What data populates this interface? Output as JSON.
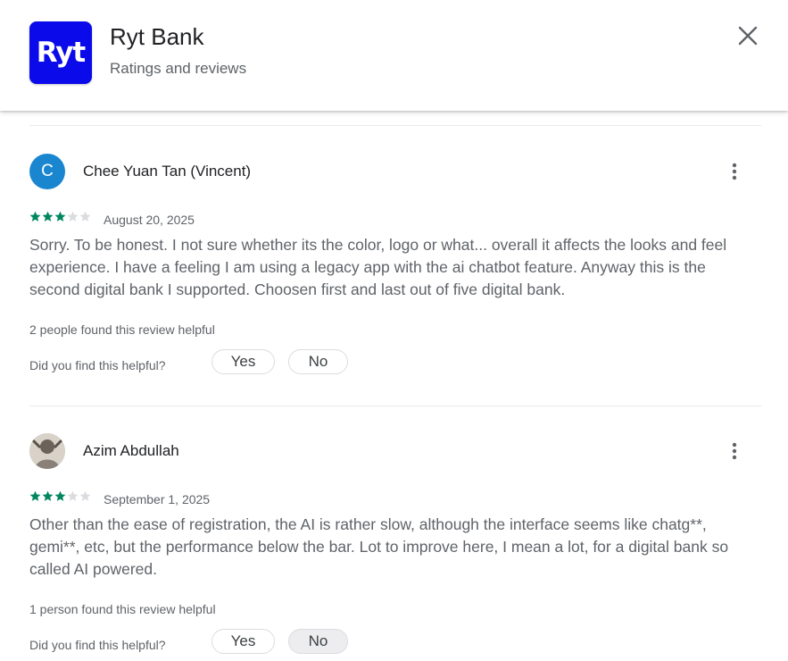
{
  "app": {
    "name": "Ryt Bank",
    "subtitle": "Ratings and reviews",
    "icon_text": "Ryt",
    "icon_color": "#0a0aeb",
    "icon_name": "ryt-bank-logo"
  },
  "header": {
    "close_icon": "close-icon"
  },
  "colors": {
    "star_filled": "#01875f",
    "star_empty": "#dadce0",
    "avatar_c": "#1a86d0"
  },
  "reviews": [
    {
      "name": "Chee Yuan Tan (Vincent)",
      "avatar_letter": "C",
      "rating": 3,
      "max_rating": 5,
      "date": "August 20, 2025",
      "text": "Sorry. To be honest. I not sure whether its the color, logo or what... overall it affects the looks and feel experience. I have a feeling I am using a legacy app with the ai chatbot feature. Anyway this is the second digital bank I supported. Choosen first and last out of five digital bank.",
      "helpful_count": "2 people found this review helpful",
      "helpful_question": "Did you find this helpful?",
      "yes_label": "Yes",
      "no_label": "No"
    },
    {
      "name": "Azim Abdullah",
      "avatar_letter": "",
      "rating": 3,
      "max_rating": 5,
      "date": "September 1, 2025",
      "text": "Other than the ease of registration, the AI is rather slow, although the interface seems like chatg**, gemi**, etc, but the performance below the bar. Lot to improve here, I mean a lot, for a digital bank so called AI powered.",
      "helpful_count": "1 person found this review helpful",
      "helpful_question": "Did you find this helpful?",
      "yes_label": "Yes",
      "no_label": "No"
    }
  ]
}
